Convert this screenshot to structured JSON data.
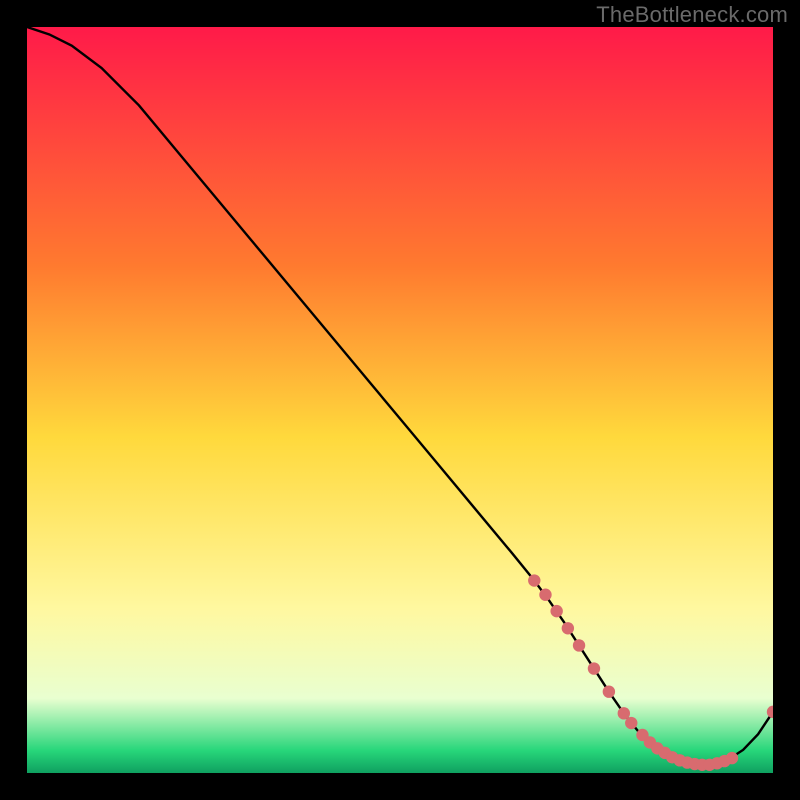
{
  "watermark": "TheBottleneck.com",
  "colors": {
    "bg": "#000000",
    "grad_top": "#ff1a49",
    "grad_mid1": "#ff7a2f",
    "grad_mid2": "#ffd93c",
    "grad_mid3": "#fff8a0",
    "grad_low": "#e9ffd0",
    "grad_green": "#27d67a",
    "grad_deep": "#0fa060",
    "curve": "#000000",
    "marker_fill": "#d86b6f",
    "marker_stroke": "#d86b6f"
  },
  "chart_data": {
    "type": "line",
    "title": "",
    "xlabel": "",
    "ylabel": "",
    "xlim": [
      0,
      100
    ],
    "ylim": [
      0,
      100
    ],
    "series": [
      {
        "name": "curve",
        "x": [
          0,
          3,
          6,
          10,
          15,
          20,
          25,
          30,
          35,
          40,
          45,
          50,
          55,
          60,
          65,
          68,
          70,
          72,
          74,
          76,
          78,
          80,
          82,
          84,
          86,
          88,
          90,
          92,
          94,
          96,
          98,
          100
        ],
        "y": [
          100,
          99,
          97.5,
          94.5,
          89.5,
          83.5,
          77.5,
          71.5,
          65.5,
          59.5,
          53.5,
          47.5,
          41.5,
          35.5,
          29.5,
          25.8,
          23.1,
          20.2,
          17.1,
          14.0,
          10.9,
          8.0,
          5.5,
          3.6,
          2.3,
          1.5,
          1.1,
          1.2,
          1.8,
          3.1,
          5.2,
          8.2
        ]
      }
    ],
    "markers": {
      "name": "highlighted-points",
      "x": [
        68,
        69.5,
        71,
        72.5,
        74,
        76,
        78,
        80,
        81,
        82.5,
        83.5,
        84.5,
        85.5,
        86.5,
        87.5,
        88.5,
        89.5,
        90.5,
        91.5,
        92.5,
        93.5,
        94.5,
        100
      ],
      "y": [
        25.8,
        23.9,
        21.7,
        19.4,
        17.1,
        14.0,
        10.9,
        8.0,
        6.7,
        5.1,
        4.1,
        3.3,
        2.7,
        2.1,
        1.7,
        1.4,
        1.2,
        1.1,
        1.1,
        1.3,
        1.6,
        2.0,
        8.2
      ]
    }
  }
}
